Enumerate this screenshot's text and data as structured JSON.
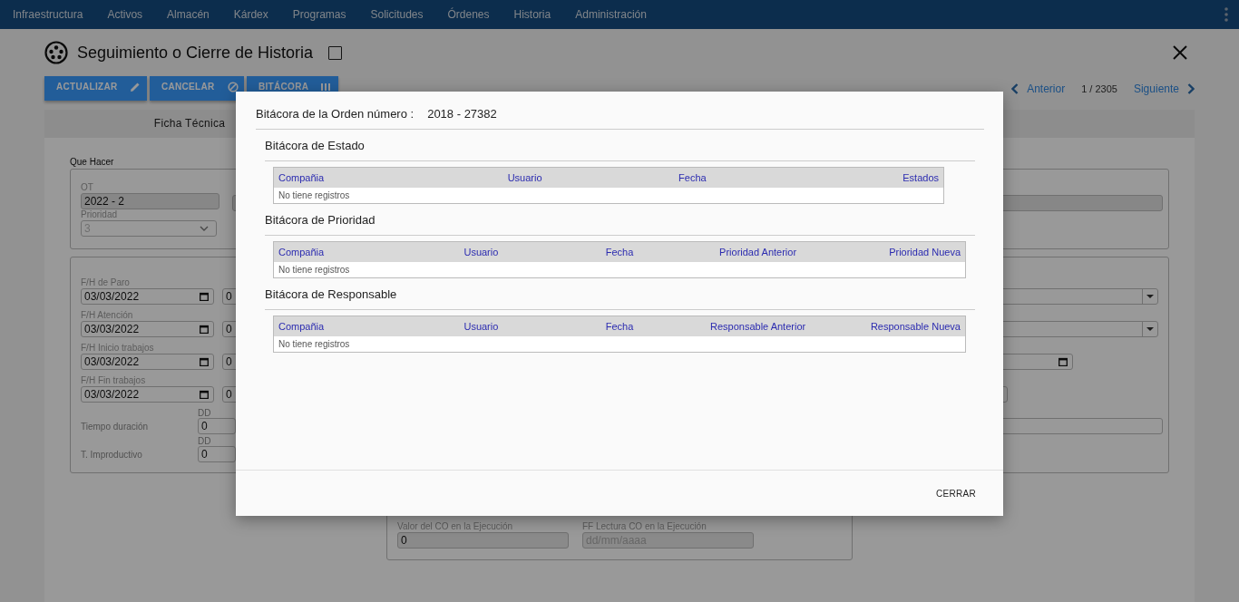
{
  "nav": {
    "items": [
      {
        "label": "Infraestructura"
      },
      {
        "label": "Activos"
      },
      {
        "label": "Almacén"
      },
      {
        "label": "Kárdex"
      },
      {
        "label": "Programas"
      },
      {
        "label": "Solicitudes"
      },
      {
        "label": "Órdenes"
      },
      {
        "label": "Historia"
      },
      {
        "label": "Administración"
      }
    ]
  },
  "page": {
    "title": "Seguimiento o Cierre de Historia",
    "title_checkbox": {
      "checked": false
    },
    "actions": [
      {
        "label": "ACTUALIZAR",
        "kind": "edit"
      },
      {
        "label": "CANCELAR",
        "kind": "cancel"
      },
      {
        "label": "BITÁCORA",
        "kind": "log"
      }
    ],
    "pager": {
      "previous": "Anterior",
      "position": "1 / 2305",
      "next": "Siguiente"
    },
    "tabs": [
      {
        "label": "Ficha Técnica",
        "selected": true
      }
    ]
  },
  "form": {
    "section_label": "Que Hacer",
    "ot": {
      "label": "OT",
      "value": "2022 - 2"
    },
    "priority": {
      "label": "Prioridad",
      "value": "3",
      "disabled": true
    },
    "dates": [
      {
        "label": "F/H de Paro",
        "date": "03/03/2022",
        "time": "0"
      },
      {
        "label": "F/H Atención",
        "date": "03/03/2022",
        "time": "0"
      },
      {
        "label": "F/H Inicio trabajos",
        "date": "03/03/2022",
        "time": "0"
      },
      {
        "label": "F/H Fin trabajos",
        "date": "03/03/2022",
        "time": "0"
      }
    ],
    "durations": [
      {
        "label": "Tiempo duración",
        "unit": "DD",
        "value": "0"
      },
      {
        "label": "T. Improductivo",
        "unit": "DD",
        "value": "0"
      }
    ],
    "execution": [
      {
        "label": "Valor del CO en la Ejecución",
        "value": "0"
      },
      {
        "label": "FF Lectura CO en la Ejecución",
        "placeholder": "dd/mm/aaaa"
      }
    ]
  },
  "dialog": {
    "title": "Bitácora de la Orden número :",
    "order": "2018 - 27382",
    "sections": [
      {
        "title": "Bitácora de Estado",
        "columns": [
          "Compañia",
          "Usuario",
          "Fecha",
          "Estados"
        ],
        "empty": "No tiene registros"
      },
      {
        "title": "Bitácora de Prioridad",
        "columns": [
          "Compañia",
          "Usuario",
          "Fecha",
          "Prioridad Anterior",
          "Prioridad Nueva"
        ],
        "empty": "No tiene registros"
      },
      {
        "title": "Bitácora de Responsable",
        "columns": [
          "Compañia",
          "Usuario",
          "Fecha",
          "Responsable Anterior",
          "Responsable Nueva"
        ],
        "empty": "No tiene registros"
      }
    ],
    "close": "CERRAR"
  }
}
